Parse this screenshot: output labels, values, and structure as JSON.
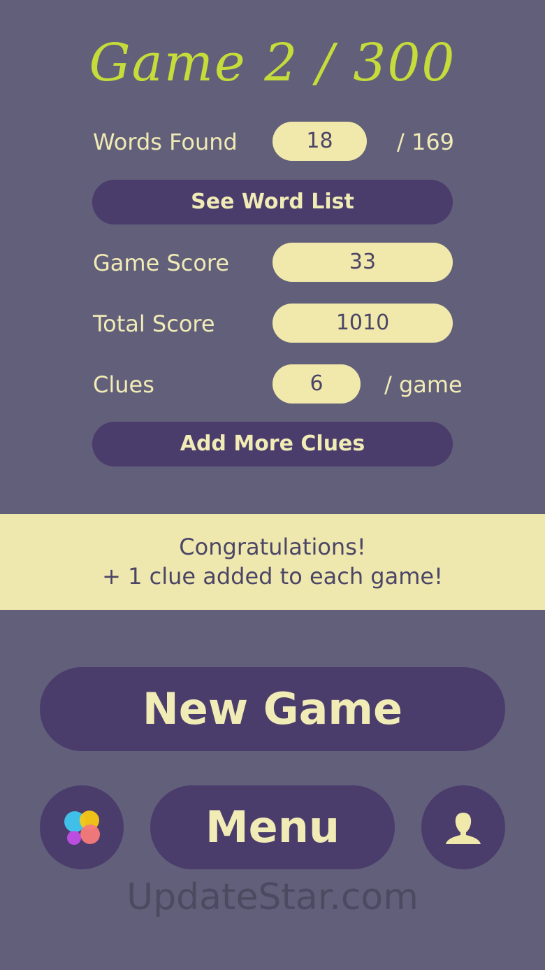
{
  "header": {
    "title": "Game 2 / 300"
  },
  "stats": {
    "words_found": {
      "label": "Words Found",
      "value": "18",
      "suffix": "/ 169"
    },
    "game_score": {
      "label": "Game Score",
      "value": "33"
    },
    "total_score": {
      "label": "Total Score",
      "value": "1010"
    },
    "clues": {
      "label": "Clues",
      "value": "6",
      "suffix": "/ game"
    }
  },
  "buttons": {
    "see_word_list": "See Word List",
    "add_more_clues": "Add More Clues",
    "new_game": "New Game",
    "menu": "Menu"
  },
  "banner": {
    "line1": "Congratulations!",
    "line2": "+ 1 clue added to each game!"
  },
  "icons": {
    "left": "game-center-icon",
    "right": "profile-icon"
  },
  "watermark": "UpdateStar.com",
  "colors": {
    "background": "#625f7a",
    "button": "#4a3c6b",
    "pill": "#f1e9ab",
    "title": "#c5dc3a",
    "text_light": "#f1ebb6"
  }
}
